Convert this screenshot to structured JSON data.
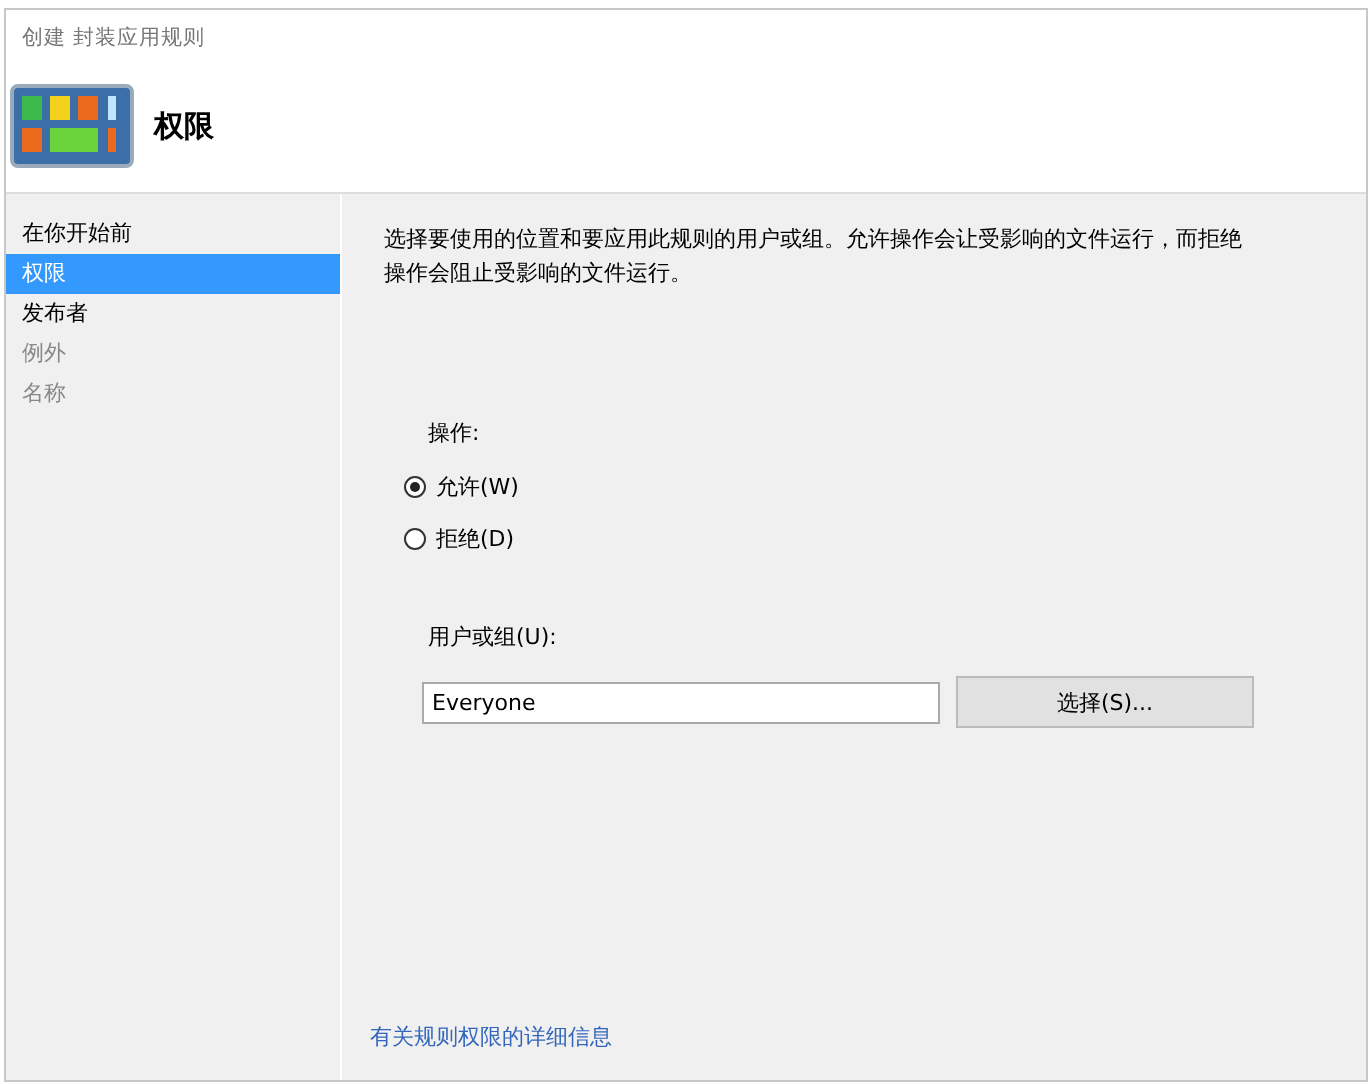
{
  "window": {
    "title": "创建 封装应用规则"
  },
  "header": {
    "title": "权限"
  },
  "sidebar": {
    "items": [
      {
        "label": "在你开始前",
        "selected": false,
        "disabled": false
      },
      {
        "label": "权限",
        "selected": true,
        "disabled": false
      },
      {
        "label": "发布者",
        "selected": false,
        "disabled": false
      },
      {
        "label": "例外",
        "selected": false,
        "disabled": true
      },
      {
        "label": "名称",
        "selected": false,
        "disabled": true
      }
    ]
  },
  "content": {
    "description": "选择要使用的位置和要应用此规则的用户或组。允许操作会让受影响的文件运行，而拒绝操作会阻止受影响的文件运行。",
    "action_label": "操作:",
    "actions": [
      {
        "label": "允许(W)",
        "selected": true
      },
      {
        "label": "拒绝(D)",
        "selected": false
      }
    ],
    "user_label": "用户或组(U):",
    "user_field": {
      "value": "Everyone"
    },
    "select_button": "选择(S)...",
    "help_link": "有关规则权限的详细信息"
  }
}
